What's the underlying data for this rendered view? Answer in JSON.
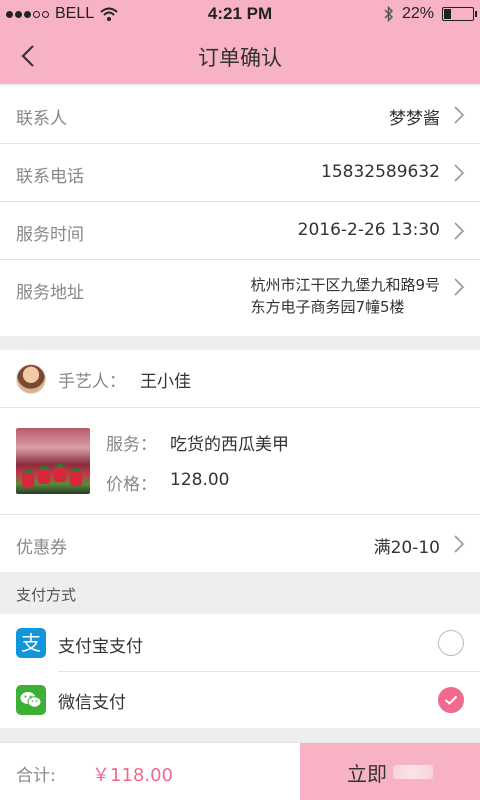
{
  "status": {
    "carrier": "BELL",
    "time": "4:21 PM",
    "battery": "22%",
    "battery_level": 0.22
  },
  "header": {
    "title": "订单确认"
  },
  "contact": {
    "rows": [
      {
        "label": "联系人",
        "value": "梦梦酱"
      },
      {
        "label": "联系电话",
        "value": "15832589632"
      },
      {
        "label": "服务时间",
        "value": "2016-2-26 13:30"
      },
      {
        "label": "服务地址",
        "value_line1": "杭州市江干区九堡九和路9号",
        "value_line2": "东方电子商务园7幢5楼"
      }
    ]
  },
  "artisan": {
    "label": "手艺人：",
    "name": "王小佳"
  },
  "service": {
    "service_label": "服务：",
    "service_name": "吃货的西瓜美甲",
    "price_label": "价格：",
    "price": "128.00"
  },
  "coupon": {
    "label": "优惠券",
    "value": "满20-10"
  },
  "payment": {
    "header": "支付方式",
    "options": [
      {
        "label": "支付宝支付",
        "icon": "alipay-icon",
        "selected": false
      },
      {
        "label": "微信支付",
        "icon": "wechat-icon",
        "selected": true
      }
    ]
  },
  "footer": {
    "total_label": "合计:",
    "total_value": "￥118.00",
    "submit_label": "立即"
  },
  "colors": {
    "accent": "#f7b3c3",
    "price": "#f06a8f",
    "check": "#f06a8f"
  }
}
